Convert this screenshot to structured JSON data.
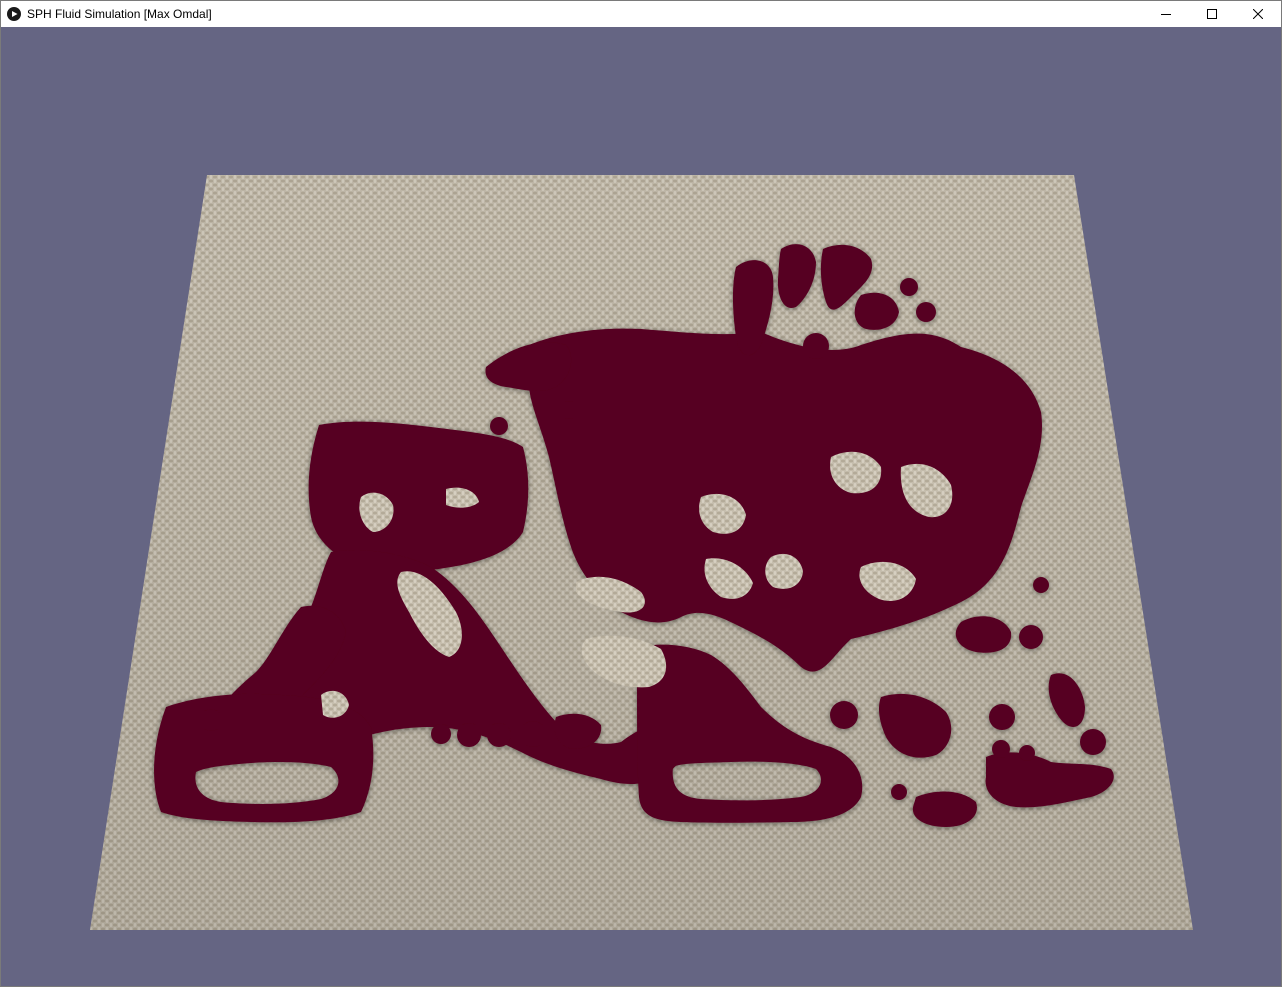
{
  "window": {
    "title": "SPH Fluid Simulation [Max Omdal]",
    "icon": "play-circle-icon",
    "controls": {
      "minimize_icon": "minimize-icon",
      "maximize_icon": "maximize-icon",
      "close_icon": "close-icon"
    }
  },
  "scene": {
    "background_color": "#656583",
    "floor_texture": "woven-canvas",
    "floor_color": "#c4bcac",
    "fluid_color": "#570020"
  }
}
